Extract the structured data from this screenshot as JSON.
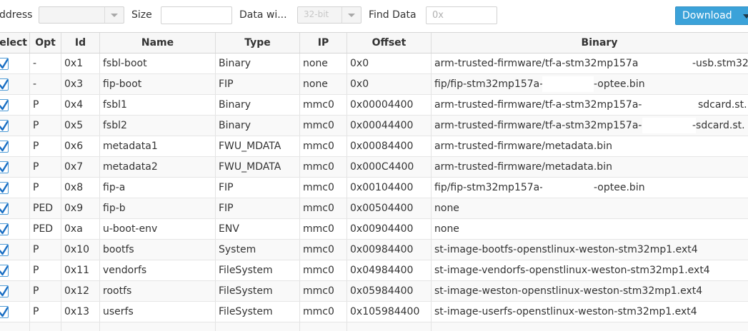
{
  "toolbar": {
    "address_label": "ddress",
    "size_label": "Size",
    "data_width_label": "Data wi...",
    "data_width_value": "32-bit",
    "find_data_label": "Find Data",
    "find_data_placeholder": "0x",
    "download_label": "Download"
  },
  "table": {
    "columns": [
      "elect",
      "Opt",
      "Id",
      "Name",
      "Type",
      "IP",
      "Offset",
      "Binary"
    ],
    "rows": [
      {
        "opt": "-",
        "id": "0x1",
        "name": "fsbl-boot",
        "type": "Binary",
        "ip": "none",
        "offset": "0x0",
        "binary": "arm-trusted-firmware/tf-a-stm32mp157a-",
        "binary_tail": "-usb.stm32",
        "checked": true
      },
      {
        "opt": "-",
        "id": "0x3",
        "name": "fip-boot",
        "type": "FIP",
        "ip": "none",
        "offset": "0x0",
        "binary": "fip/fip-stm32mp157a-",
        "binary_tail": "-optee.bin",
        "checked": true
      },
      {
        "opt": "P",
        "id": "0x4",
        "name": "fsbl1",
        "type": "Binary",
        "ip": "mmc0",
        "offset": "0x00004400",
        "binary": "arm-trusted-firmware/tf-a-stm32mp157a-",
        "binary_tail": "sdcard.st.",
        "checked": true
      },
      {
        "opt": "P",
        "id": "0x5",
        "name": "fsbl2",
        "type": "Binary",
        "ip": "mmc0",
        "offset": "0x00044400",
        "binary": "arm-trusted-firmware/tf-a-stm32mp157a-",
        "binary_tail": "-sdcard.st.",
        "checked": true
      },
      {
        "opt": "P",
        "id": "0x6",
        "name": "metadata1",
        "type": "FWU_MDATA",
        "ip": "mmc0",
        "offset": "0x00084400",
        "binary": "arm-trusted-firmware/metadata.bin",
        "binary_tail": "",
        "checked": true
      },
      {
        "opt": "P",
        "id": "0x7",
        "name": "metadata2",
        "type": "FWU_MDATA",
        "ip": "mmc0",
        "offset": "0x000C4400",
        "binary": "arm-trusted-firmware/metadata.bin",
        "binary_tail": "",
        "checked": true
      },
      {
        "opt": "P",
        "id": "0x8",
        "name": "fip-a",
        "type": "FIP",
        "ip": "mmc0",
        "offset": "0x00104400",
        "binary": "fip/fip-stm32mp157a-",
        "binary_tail": "-optee.bin",
        "checked": true
      },
      {
        "opt": "PED",
        "id": "0x9",
        "name": "fip-b",
        "type": "FIP",
        "ip": "mmc0",
        "offset": "0x00504400",
        "binary": "none",
        "binary_tail": "",
        "checked": true
      },
      {
        "opt": "PED",
        "id": "0xa",
        "name": "u-boot-env",
        "type": "ENV",
        "ip": "mmc0",
        "offset": "0x00904400",
        "binary": "none",
        "binary_tail": "",
        "checked": true
      },
      {
        "opt": "P",
        "id": "0x10",
        "name": "bootfs",
        "type": "System",
        "ip": "mmc0",
        "offset": "0x00984400",
        "binary": "st-image-bootfs-openstlinux-weston-stm32mp1.ext4",
        "binary_tail": "",
        "checked": true
      },
      {
        "opt": "P",
        "id": "0x11",
        "name": "vendorfs",
        "type": "FileSystem",
        "ip": "mmc0",
        "offset": "0x04984400",
        "binary": "st-image-vendorfs-openstlinux-weston-stm32mp1.ext4",
        "binary_tail": "",
        "checked": true
      },
      {
        "opt": "P",
        "id": "0x12",
        "name": "rootfs",
        "type": "FileSystem",
        "ip": "mmc0",
        "offset": "0x05984400",
        "binary": "st-image-weston-openstlinux-weston-stm32mp1.ext4",
        "binary_tail": "",
        "checked": true
      },
      {
        "opt": "P",
        "id": "0x13",
        "name": "userfs",
        "type": "FileSystem",
        "ip": "mmc0",
        "offset": "0x105984400",
        "binary": "st-image-userfs-openstlinux-weston-stm32mp1.ext4",
        "binary_tail": "",
        "checked": true
      }
    ]
  },
  "colors": {
    "accent": "#3ba2d9",
    "checkbox_border": "#4e9bd6",
    "checkmark": "#1a6fc4"
  }
}
